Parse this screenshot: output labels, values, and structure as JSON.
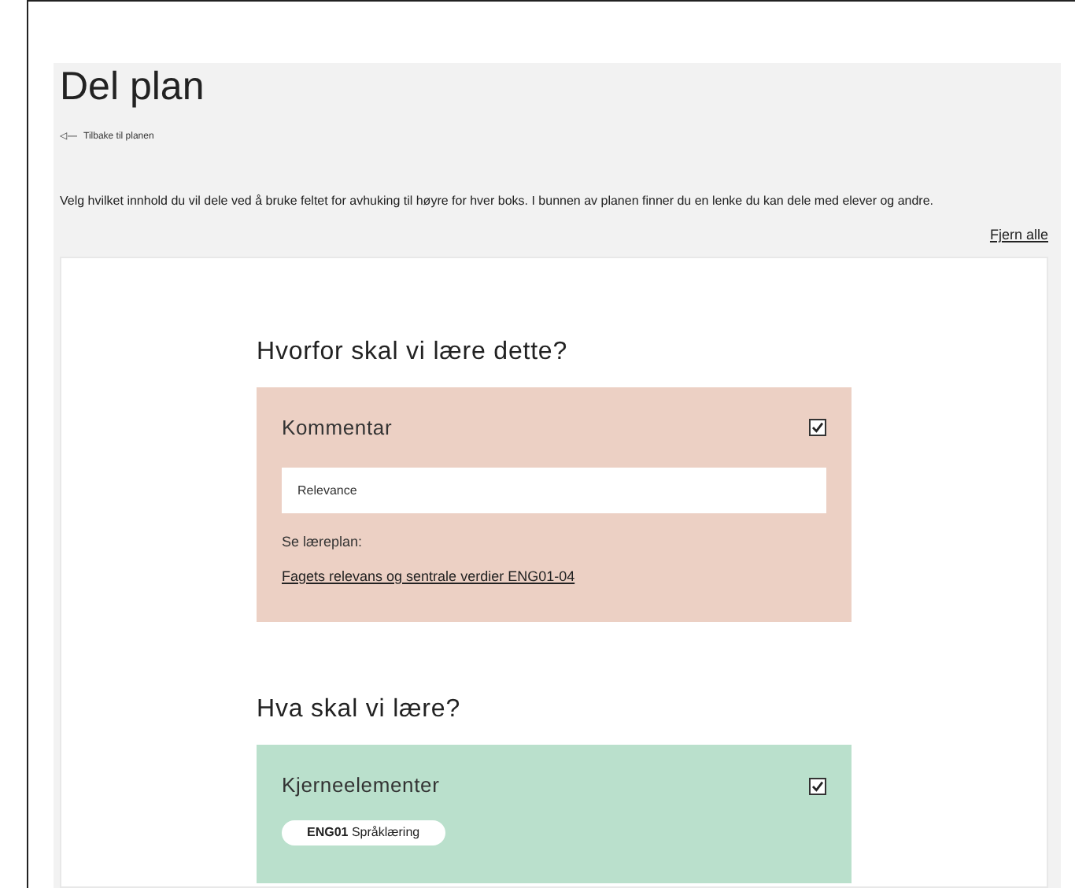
{
  "title": "Del plan",
  "back_link": {
    "arrow": "◁—",
    "label": "Tilbake til planen"
  },
  "instructions": "Velg hvilket innhold du vil dele ved å bruke feltet for avhuking til høyre for hver boks. I bunnen av planen finner du en lenke du kan dele med elever og andre.",
  "remove_all": "Fjern alle",
  "sections": [
    {
      "heading": "Hvorfor skal vi lære dette?",
      "box": {
        "kind": "comment",
        "title": "Kommentar",
        "checked": true,
        "color": "#ecd0c4",
        "value": "Relevance",
        "see_label": "Se læreplan:",
        "link": "Fagets relevans og sentrale verdier ENG01-04"
      }
    },
    {
      "heading": "Hva skal vi lære?",
      "box": {
        "kind": "elements",
        "title": "Kjerneelementer",
        "checked": true,
        "color": "#bae0cc",
        "tags": [
          {
            "code": "ENG01",
            "label": "Språklæring"
          }
        ]
      }
    }
  ]
}
